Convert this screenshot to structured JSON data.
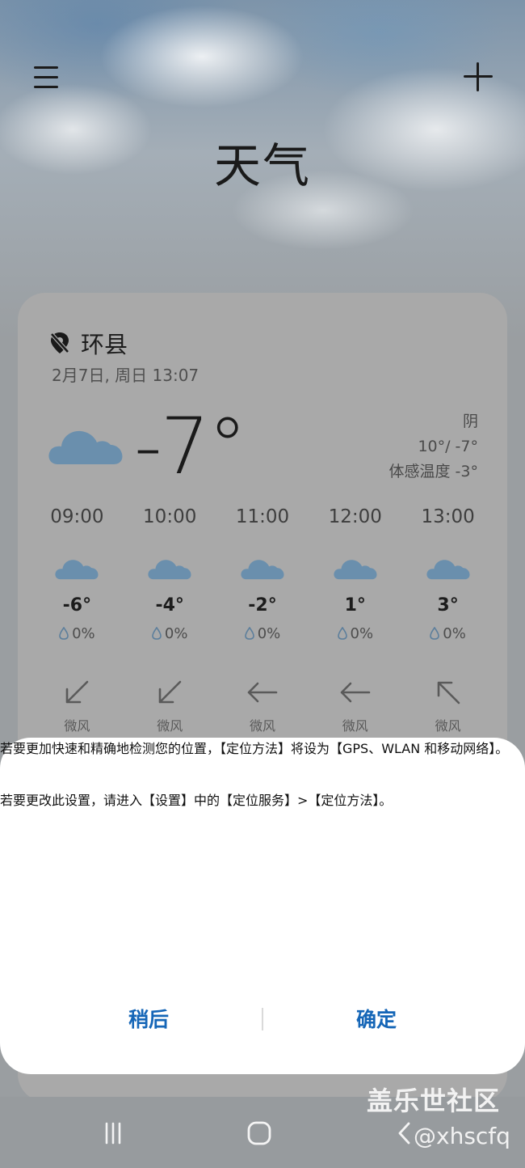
{
  "app": {
    "title": "天气"
  },
  "location": {
    "name": "环县",
    "datetime": "2月7日, 周日 13:07"
  },
  "current": {
    "temp": "-7°",
    "condition": "阴",
    "range": "10°/ -7°",
    "feels_like": "体感温度 -3°",
    "icon": "cloud-icon"
  },
  "hourly": [
    {
      "time": "09:00",
      "temp": "-6°",
      "precip": "0%",
      "wind": "微风",
      "arrow": "arrow-down-left-icon"
    },
    {
      "time": "10:00",
      "temp": "-4°",
      "precip": "0%",
      "wind": "微风",
      "arrow": "arrow-down-left-icon"
    },
    {
      "time": "11:00",
      "temp": "-2°",
      "precip": "0%",
      "wind": "微风",
      "arrow": "arrow-left-icon"
    },
    {
      "time": "12:00",
      "temp": "1°",
      "precip": "0%",
      "wind": "微风",
      "arrow": "arrow-left-icon"
    },
    {
      "time": "13:00",
      "temp": "3°",
      "precip": "0%",
      "wind": "微风",
      "arrow": "arrow-up-left-icon"
    }
  ],
  "dialog": {
    "message_1": "若要更加快速和精确地检测您的位置，【定位方法】将设为【GPS、WLAN 和移动网络】。",
    "message_2": "若要更改此设置，请进入【设置】中的【定位服务】>【定位方法】。",
    "later_label": "稍后",
    "ok_label": "确定"
  },
  "watermark": {
    "line1": "盖乐世社区",
    "line2": "@xhscfq"
  },
  "colors": {
    "accent": "#1566b7",
    "cloud": "#6a8fad",
    "dialog_bg": "#ffffff"
  }
}
